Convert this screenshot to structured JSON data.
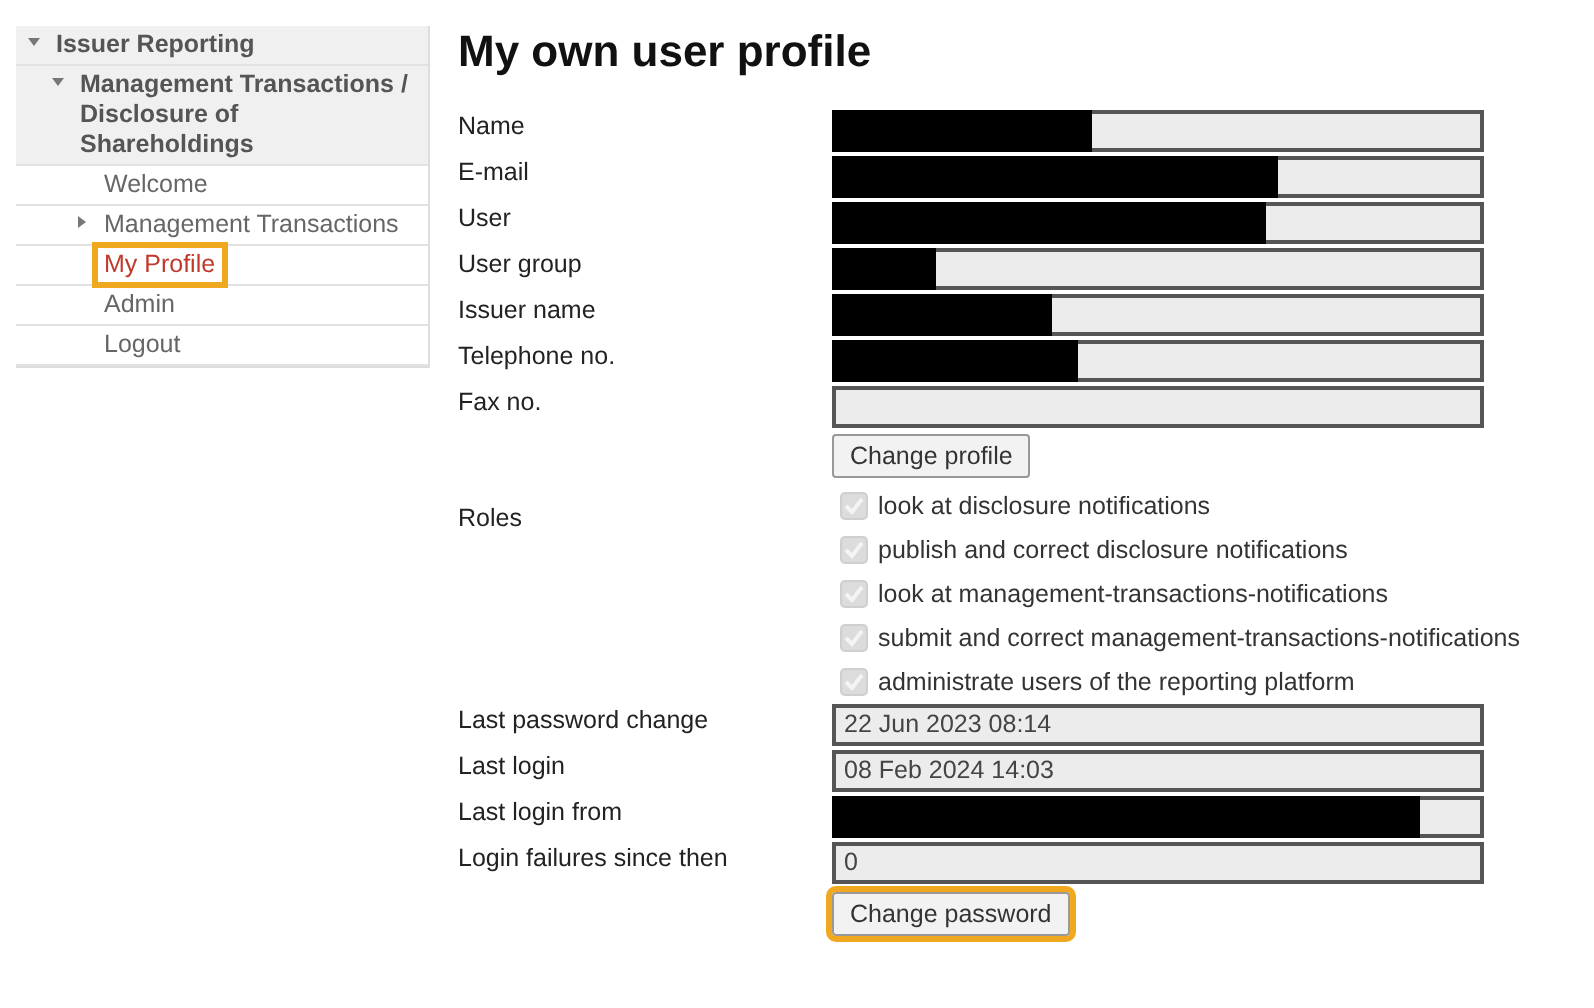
{
  "sidebar": {
    "items": [
      {
        "label": "Issuer Reporting",
        "expanded": true,
        "children": [
          {
            "label": "Management Transactions / Disclosure of Shareholdings",
            "expanded": true,
            "children": [
              {
                "label": "Welcome",
                "selected": false,
                "highlighted": false
              },
              {
                "label": "Management Transactions",
                "expanded": false,
                "selected": false,
                "highlighted": false
              },
              {
                "label": "My Profile",
                "selected": true,
                "highlighted": true
              },
              {
                "label": "Admin",
                "selected": false,
                "highlighted": false
              },
              {
                "label": "Logout",
                "selected": false,
                "highlighted": false
              }
            ]
          }
        ]
      }
    ]
  },
  "title": "My own user profile",
  "fields": [
    {
      "label": "Name",
      "level": 0.39
    },
    {
      "label": "E-mail",
      "level": 0.68
    },
    {
      "label": "User",
      "level": 0.66
    },
    {
      "label": "User group",
      "level": 0.15
    },
    {
      "label": "Issuer name",
      "level": 0.33
    },
    {
      "label": "Telephone no.",
      "level": 0.37
    },
    {
      "label": "Fax no."
    }
  ],
  "profile_button": {
    "label": "Change profile",
    "highlighted": false
  },
  "roles": {
    "label": "Roles",
    "items": [
      {
        "label": "look at disclosure notifications",
        "checked": true,
        "disabled": true
      },
      {
        "label": "publish and correct disclosure notifications",
        "checked": true,
        "disabled": true
      },
      {
        "label": "look at management-transactions-notifications",
        "checked": true,
        "disabled": true
      },
      {
        "label": "submit and correct management-transactions-notifications",
        "checked": true,
        "disabled": true
      },
      {
        "label": "administrate users of the reporting platform",
        "checked": true,
        "disabled": true
      }
    ]
  },
  "login_fields": [
    {
      "label": "Last password change",
      "value": "22 Jun 2023 08:14"
    },
    {
      "label": "Last login",
      "value": "08 Feb 2024 14:03"
    },
    {
      "label": "Last login from",
      "level": 0.9
    },
    {
      "label": "Login failures since then",
      "value": "0"
    }
  ],
  "password_button": {
    "label": "Change password",
    "highlighted": true
  }
}
